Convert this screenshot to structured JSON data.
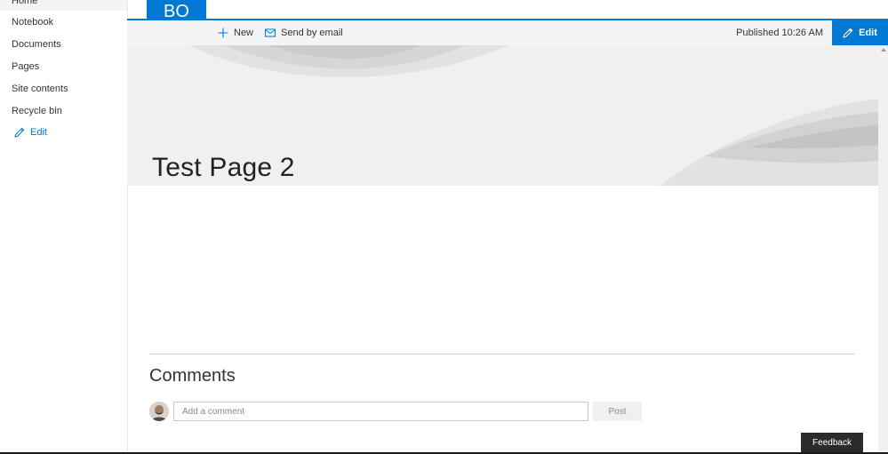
{
  "sidebar": {
    "items": [
      {
        "label": "Home"
      },
      {
        "label": "Notebook"
      },
      {
        "label": "Documents"
      },
      {
        "label": "Pages"
      },
      {
        "label": "Site contents"
      },
      {
        "label": "Recycle bin"
      }
    ],
    "edit_label": "Edit",
    "edit_icon": "pencil-icon"
  },
  "site": {
    "logo_initials": "BO",
    "brand_color": "#0078d4"
  },
  "commandbar": {
    "new_label": "New",
    "new_icon": "plus-icon",
    "email_label": "Send by email",
    "email_icon": "mail-icon",
    "published_status": "Published 10:26 AM",
    "edit_label": "Edit",
    "edit_icon": "pencil-icon"
  },
  "page": {
    "title": "Test Page 2"
  },
  "comments": {
    "title": "Comments",
    "input_placeholder": "Add a comment",
    "post_label": "Post"
  },
  "feedback": {
    "label": "Feedback"
  }
}
